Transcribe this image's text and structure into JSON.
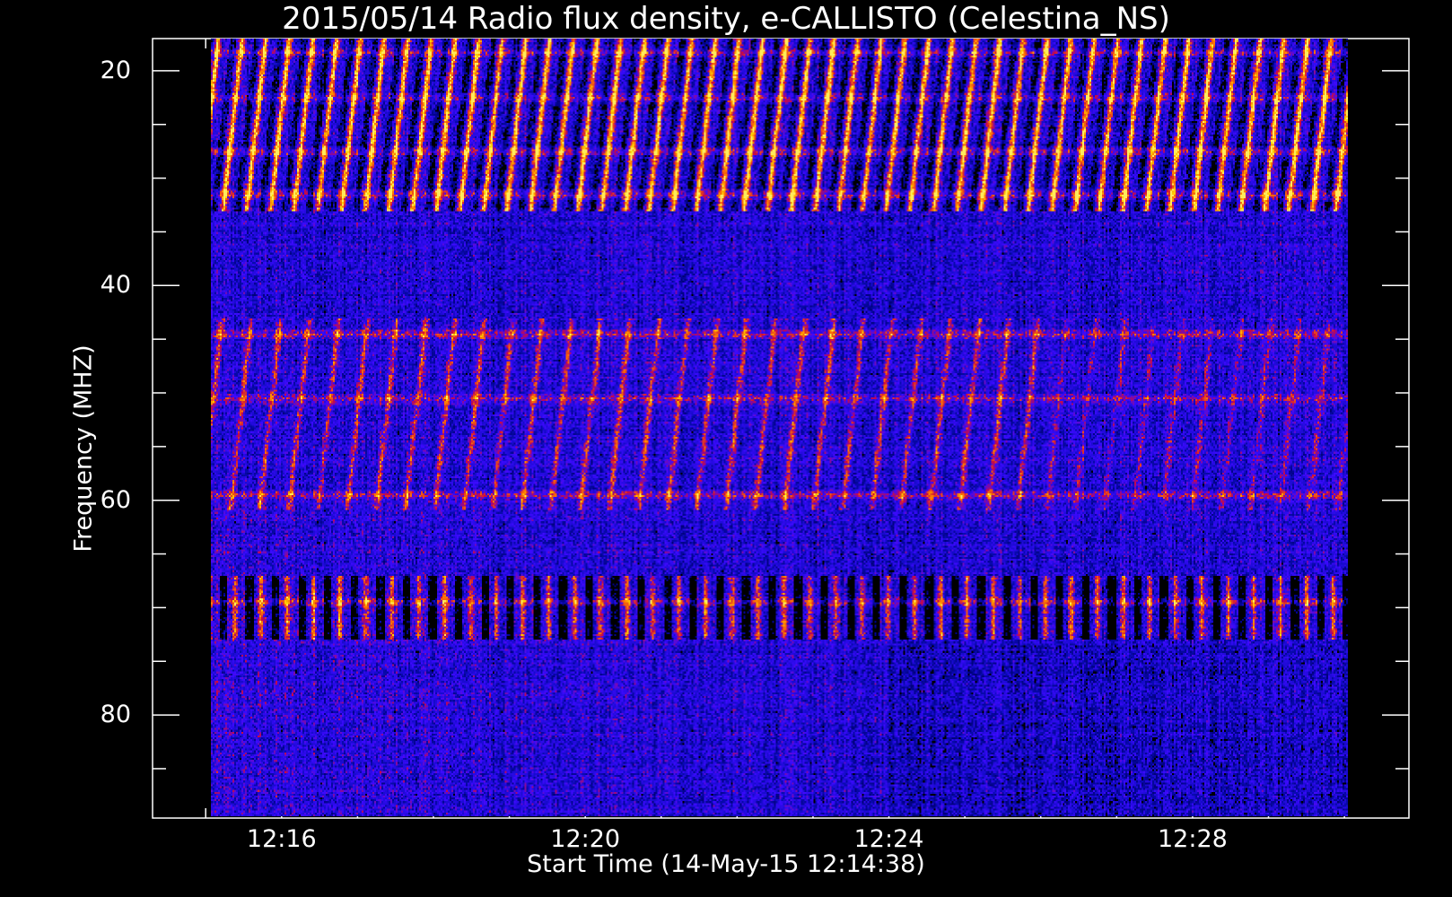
{
  "chart_data": {
    "type": "heatmap",
    "title": "2015/05/14  Radio flux density, e-CALLISTO (Celestina_NS)",
    "xlabel": "Start Time (14-May-15 12:14:38)",
    "ylabel": "Frequency (MHZ)",
    "x_tick_labels": [
      "12:16",
      "12:20",
      "12:24",
      "12:28"
    ],
    "x_tick_minutes": [
      16,
      20,
      24,
      28
    ],
    "x_minor_step_minutes": 1,
    "xlim_minutes": [
      14.3,
      30.85
    ],
    "y_tick_labels": [
      "20",
      "40",
      "60",
      "80"
    ],
    "y_tick_values": [
      20,
      40,
      60,
      80
    ],
    "y_minor_step": 5,
    "ylim": [
      17,
      89.6
    ],
    "y_inverted": true,
    "data_extent": {
      "x_minutes": [
        15.07,
        30.05
      ],
      "y_mhz": [
        17,
        89.4
      ]
    },
    "colormap": [
      "#000000",
      "#2020d0",
      "#0000ff",
      "#c01010",
      "#ff4000",
      "#ff9900",
      "#ffee44"
    ],
    "features": {
      "type_iii_burst_bands_mhz": [
        [
          17,
          33
        ],
        [
          44,
          61
        ],
        [
          68,
          72
        ]
      ],
      "bright_horizontal_lines_mhz": [
        18.2,
        22.5,
        27.5,
        31.5,
        44.5,
        50.5,
        59.5,
        69.5
      ]
    }
  }
}
